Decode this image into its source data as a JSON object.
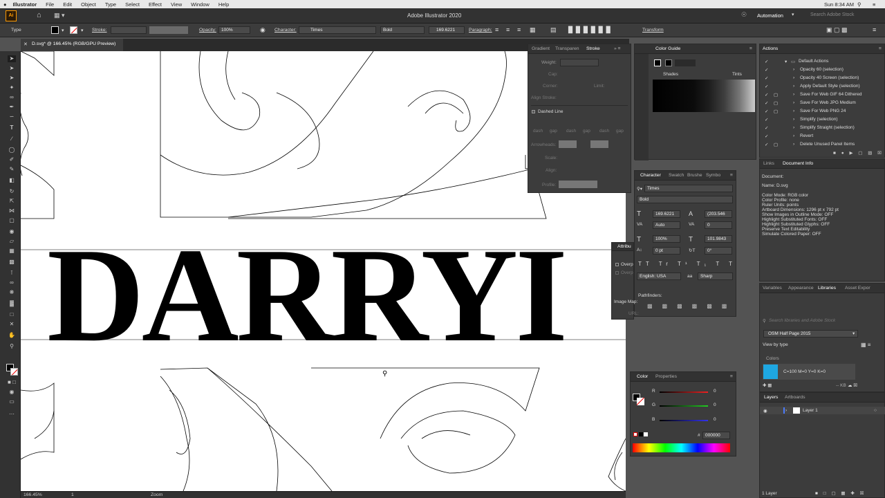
{
  "menubar": {
    "apple": "",
    "app": "Illustrator",
    "items": [
      "File",
      "Edit",
      "Object",
      "Type",
      "Select",
      "Effect",
      "View",
      "Window",
      "Help"
    ],
    "clock": "Sun 8:34 AM"
  },
  "appbar": {
    "title": "Adobe Illustrator 2020",
    "workspace": "Automation",
    "search_placeholder": "Search Adobe Stock"
  },
  "control": {
    "type_label": "Type",
    "stroke_label": "Stroke:",
    "opacity_label": "Opacity:",
    "opacity_value": "100%",
    "character_label": "Character:",
    "font": "Times",
    "style": "Bold",
    "size": "169.6221",
    "paragraph_label": "Paragraph:",
    "transform_label": "Transform"
  },
  "document_tab": {
    "label": "D.svg* @ 166.45% (RGB/GPU Preview)"
  },
  "artwork": {
    "text": "DARRYI"
  },
  "status": {
    "zoom": "166.45%",
    "page": "1",
    "mode": "Zoom"
  },
  "stroke_panel": {
    "tabs": [
      "Gradient",
      "Transparen",
      "Stroke"
    ],
    "weight": "Weight:",
    "cap": "Cap:",
    "corner": "Corner:",
    "limit": "Limit:",
    "align": "Align Stroke:",
    "dashed": "Dashed Line",
    "dash_labels": [
      "dash",
      "gap",
      "dash",
      "gap",
      "dash",
      "gap"
    ],
    "arrowheads": "Arrowheads:",
    "scale": "Scale:",
    "align2": "Align:",
    "profile": "Profile:"
  },
  "color_guide": {
    "title": "Color Guide",
    "shades": "Shades",
    "tints": "Tints"
  },
  "character_panel": {
    "tabs": [
      "Character",
      "Swatch",
      "Brushe",
      "Symbo"
    ],
    "font": "Times",
    "style": "Bold",
    "size": "169.6221",
    "leading": "(203.546",
    "kerning": "Auto",
    "tracking": "0",
    "vscale": "100%",
    "hscale": "101.9843",
    "baseline": "0 pt",
    "rotation": "0°",
    "language": "English: USA",
    "aa": "Sharp",
    "pathfinders": "Pathfinders:"
  },
  "attributes_panel": {
    "title": "Attribu",
    "overprint1": "Overp",
    "overprint2": "Overp",
    "imagemap": "Image Map:",
    "url": "URL:"
  },
  "color_panel": {
    "tabs": [
      "Color",
      "Properties"
    ],
    "channels": [
      {
        "name": "R",
        "value": "0",
        "color": "#e22"
      },
      {
        "name": "G",
        "value": "0",
        "color": "#2c2"
      },
      {
        "name": "B",
        "value": "0",
        "color": "#33e"
      }
    ],
    "hex_label": "#",
    "hex": "000000"
  },
  "actions": {
    "title": "Actions",
    "items": [
      "Default Actions",
      "Opacity 60 (selection)",
      "Opacity 40 Screen (selection)",
      "Apply Default Style (selection)",
      "Save For Web GIF 64 Dithered",
      "Save For Web JPG Medium",
      "Save For Web PNG 24",
      "Simplify (selection)",
      "Simplify Straight (selection)",
      "Revert",
      "Delete Unused Panel Items"
    ]
  },
  "docinfo": {
    "tabs": [
      "Links",
      "Document Info"
    ],
    "lines": [
      "Document:",
      "",
      "Name: D.svg",
      "",
      "Color Mode: RGB color",
      "Color Profile: none",
      "Ruler Units: points",
      "Artboard Dimensions: 1296 pt x 792 pt",
      "Show Images in Outline Mode: OFF",
      "Highlight Substituted Fonts: OFF",
      "Highlight Substituted Glyphs: OFF",
      "Preserve Text Editability",
      "Simulate Colored Paper: OFF"
    ]
  },
  "libraries": {
    "tabs": [
      "Variables",
      "Appearance",
      "Libraries",
      "Asset Expor"
    ],
    "search_placeholder": "Search libraries and Adobe Stock",
    "library": "OSM Half Page 2015",
    "view": "View by type",
    "colors_label": "Colors",
    "swatch_label": "C=100 M=0 Y=0 K=0",
    "size": "-- KB"
  },
  "layers": {
    "tabs": [
      "Layers",
      "Artboards"
    ],
    "layer": "Layer 1",
    "count": "1 Layer"
  },
  "colors": {
    "ui_dark": "#323232",
    "panel": "#3c3c3c",
    "cyan_swatch": "#1ea7e1"
  }
}
